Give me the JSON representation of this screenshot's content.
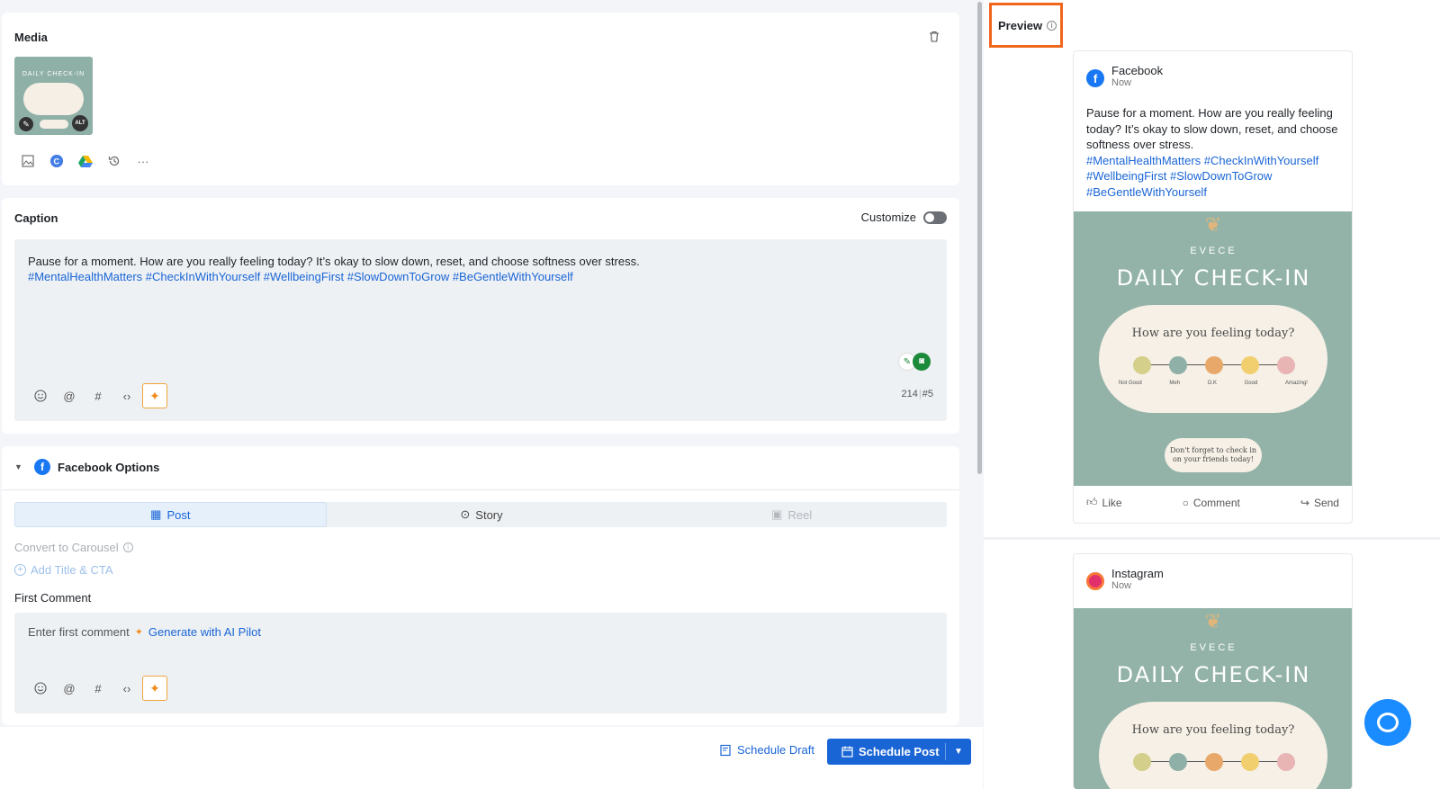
{
  "media": {
    "title": "Media",
    "thumb_brand": "EVECE",
    "thumb_title": "DAILY CHECK-IN",
    "alt_label": "ALT",
    "tools": [
      "image-library-icon",
      "canva-icon",
      "google-drive-icon",
      "history-icon",
      "more-icon"
    ]
  },
  "caption": {
    "title": "Caption",
    "customize_label": "Customize",
    "text": "Pause for a moment. How are you really feeling today? It’s okay to slow down, reset, and choose softness over stress.",
    "hashtags": "#MentalHealthMatters #CheckInWithYourself #WellbeingFirst #SlowDownToGrow #BeGentleWithYourself",
    "char_count": "214",
    "hashtag_count": "#5"
  },
  "facebook_options": {
    "title": "Facebook Options",
    "tabs": [
      {
        "label": "Post",
        "state": "active"
      },
      {
        "label": "Story",
        "state": "normal"
      },
      {
        "label": "Reel",
        "state": "disabled"
      }
    ],
    "convert_label": "Convert to Carousel",
    "add_title_label": "Add Title & CTA",
    "first_comment_label": "First Comment",
    "first_comment_placeholder": "Enter first comment",
    "generate_label": "Generate with AI Pilot"
  },
  "footer": {
    "draft_label": "Schedule Draft",
    "schedule_label": "Schedule Post"
  },
  "preview": {
    "title": "Preview",
    "facebook": {
      "name": "Facebook",
      "time": "Now",
      "text": "Pause for a moment. How are you really feeling today? It’s okay to slow down, reset, and choose softness over stress.",
      "hashtags": "#MentalHealthMatters #CheckInWithYourself #WellbeingFirst #SlowDownToGrow #BeGentleWithYourself",
      "like": "Like",
      "comment": "Comment",
      "send": "Send"
    },
    "instagram": {
      "name": "Instagram",
      "time": "Now"
    },
    "image": {
      "brand": "EVECE",
      "title": "DAILY CHECK-IN",
      "question": "How are you feeling today?",
      "scale_labels": [
        "Not Good",
        "Meh",
        "O.K",
        "Good",
        "Amazing!"
      ],
      "scale_colors": [
        "#d4cf8a",
        "#8fb0a6",
        "#e8a86a",
        "#f2cf6e",
        "#e8b4b4"
      ],
      "reminder": "Don't forget to check in on your friends today!"
    }
  },
  "colors": {
    "accent": "#1a65d6",
    "highlight": "#f0661d",
    "facebook": "#1877f2"
  }
}
